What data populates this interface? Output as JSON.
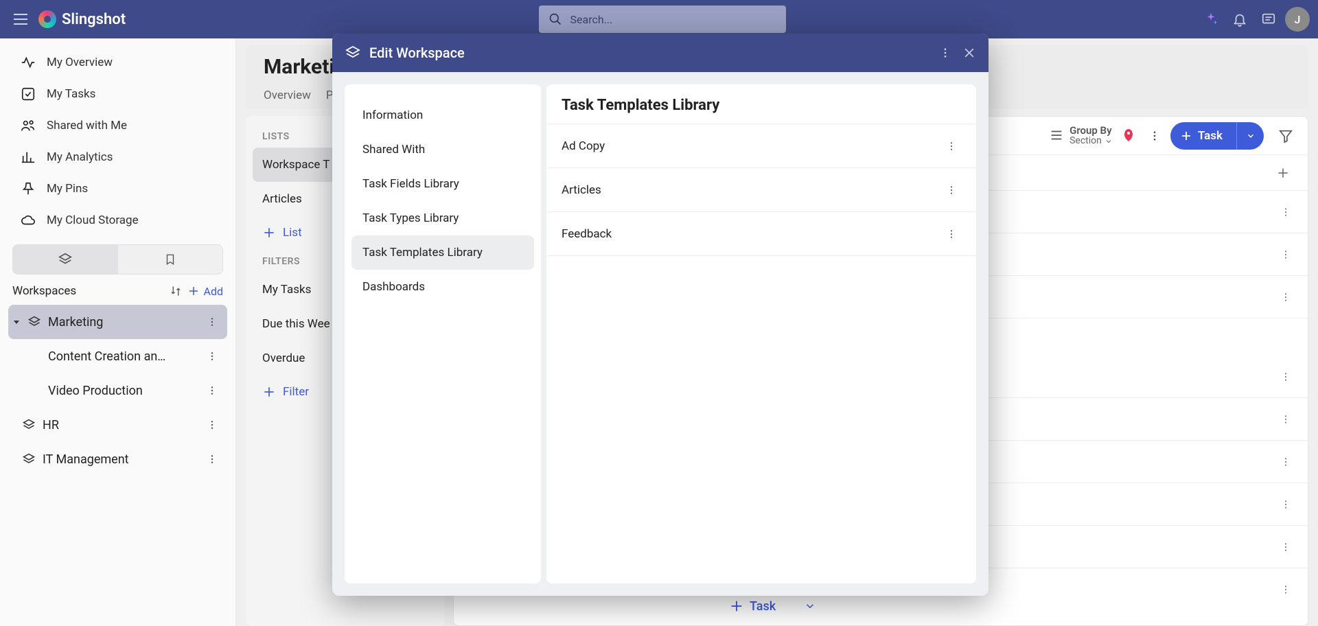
{
  "brand": {
    "name": "Slingshot"
  },
  "search": {
    "placeholder": "Search..."
  },
  "avatar": {
    "initial": "J"
  },
  "sidebar": {
    "nav": [
      {
        "label": "My Overview"
      },
      {
        "label": "My Tasks"
      },
      {
        "label": "Shared with Me"
      },
      {
        "label": "My Analytics"
      },
      {
        "label": "My Pins"
      },
      {
        "label": "My Cloud Storage"
      }
    ],
    "workspaces_label": "Workspaces",
    "add_label": "Add",
    "workspaces": [
      {
        "name": "Marketing",
        "active": true,
        "children": [
          {
            "name": "Content Creation an…"
          },
          {
            "name": "Video Production"
          }
        ]
      },
      {
        "name": "HR"
      },
      {
        "name": "IT Management"
      }
    ]
  },
  "page": {
    "title": "Marketin",
    "tabs": [
      "Overview",
      "P"
    ]
  },
  "lists": {
    "header": "LISTS",
    "items": [
      {
        "label": "Workspace T",
        "active": true
      },
      {
        "label": "Articles"
      }
    ],
    "add_label": "List",
    "filters_header": "FILTERS",
    "filters": [
      "My Tasks",
      "Due this Wee",
      "Overdue"
    ],
    "add_filter_label": "Filter"
  },
  "toolbar": {
    "groupby_label": "Group By",
    "groupby_value": "Section",
    "task_btn": "Task"
  },
  "footer": {
    "add_task": "Task"
  },
  "dialog": {
    "title": "Edit Workspace",
    "nav": [
      "Information",
      "Shared With",
      "Task Fields Library",
      "Task Types Library",
      "Task Templates Library",
      "Dashboards"
    ],
    "active_nav_index": 4,
    "content_title": "Task Templates Library",
    "templates": [
      "Ad Copy",
      "Articles",
      "Feedback"
    ]
  }
}
